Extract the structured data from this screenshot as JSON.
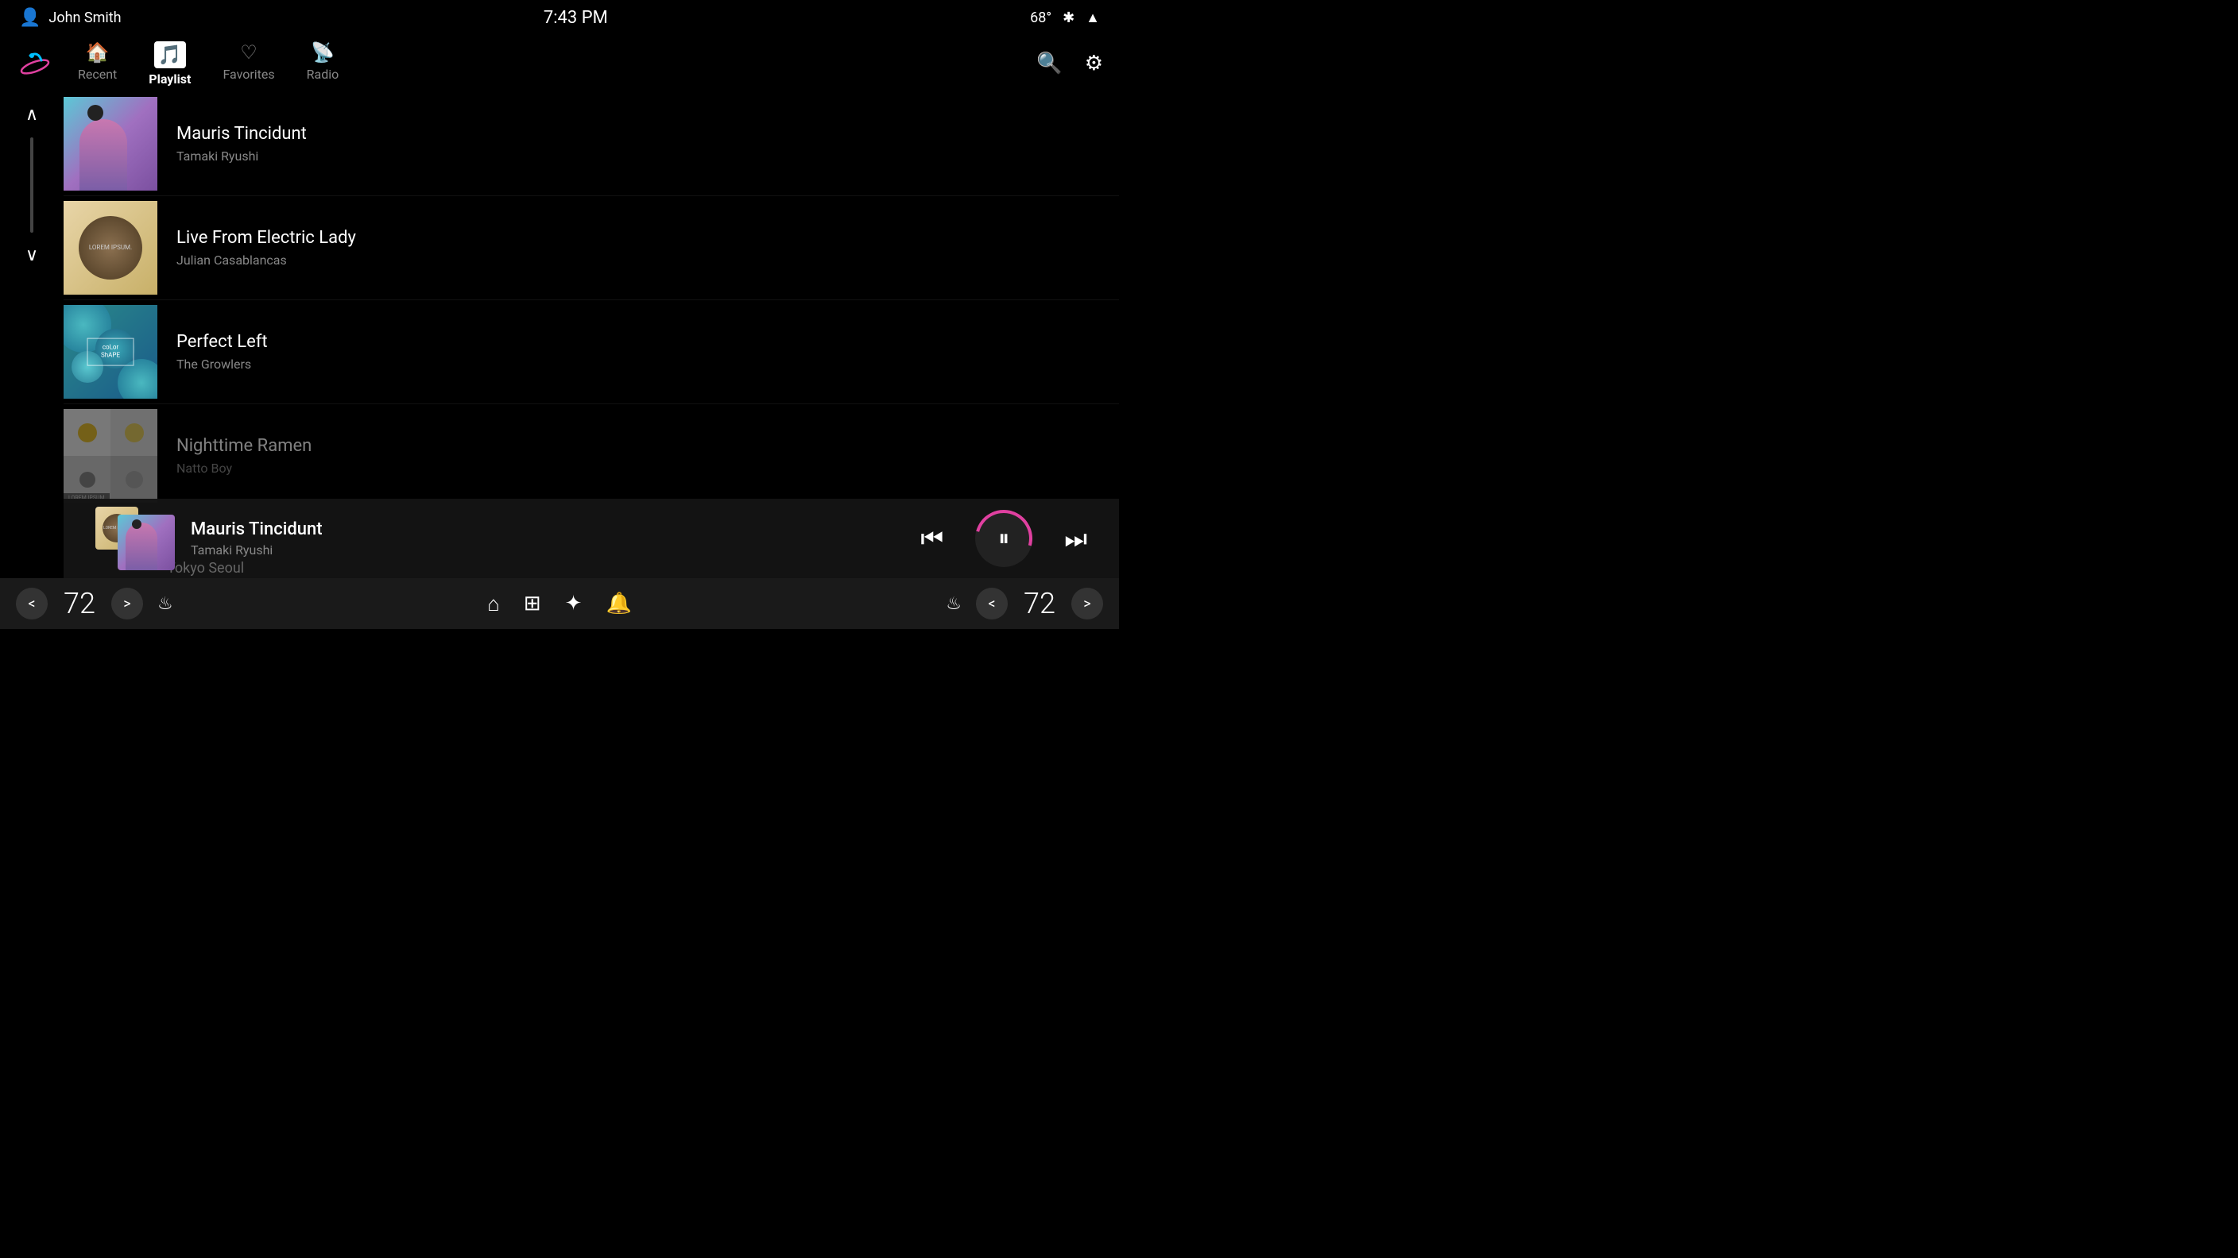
{
  "statusBar": {
    "user": "John Smith",
    "time": "7:43 PM",
    "temp": "68°",
    "bluetooth": "BT",
    "signal": "▲"
  },
  "nav": {
    "tabs": [
      {
        "id": "recent",
        "label": "Recent",
        "icon": "🏠",
        "active": false
      },
      {
        "id": "playlist",
        "label": "Playlist",
        "icon": "🎵",
        "active": true
      },
      {
        "id": "favorites",
        "label": "Favorites",
        "icon": "♡",
        "active": false
      },
      {
        "id": "radio",
        "label": "Radio",
        "icon": "📡",
        "active": false
      }
    ]
  },
  "playlist": {
    "items": [
      {
        "id": 1,
        "title": "Mauris Tincidunt",
        "artist": "Tamaki Ryushi",
        "artType": "art1"
      },
      {
        "id": 2,
        "title": "Live From Electric Lady",
        "artist": "Julian Casablancas",
        "artType": "art2"
      },
      {
        "id": 3,
        "title": "Perfect Left",
        "artist": "The Growlers",
        "artType": "art3"
      },
      {
        "id": 4,
        "title": "Nighttime Ramen",
        "artist": "Natto Boy",
        "artType": "art4"
      },
      {
        "id": 5,
        "title": "Tokyo Seoul",
        "artist": "",
        "artType": "art5"
      }
    ]
  },
  "nowPlaying": {
    "title": "Mauris Tincidunt",
    "artist": "Tamaki Ryushi",
    "isPlaying": true
  },
  "bottomBar": {
    "leftTemp": "72",
    "rightTemp": "72",
    "prevBtn": "<",
    "nextBtn": ">",
    "homeIcon": "⌂",
    "gridIcon": "⊞",
    "fanIcon": "✦",
    "bellIcon": "🔔"
  },
  "lorem": "LOREM\nIPSUM.",
  "colorShape": "coLor ShAPE"
}
